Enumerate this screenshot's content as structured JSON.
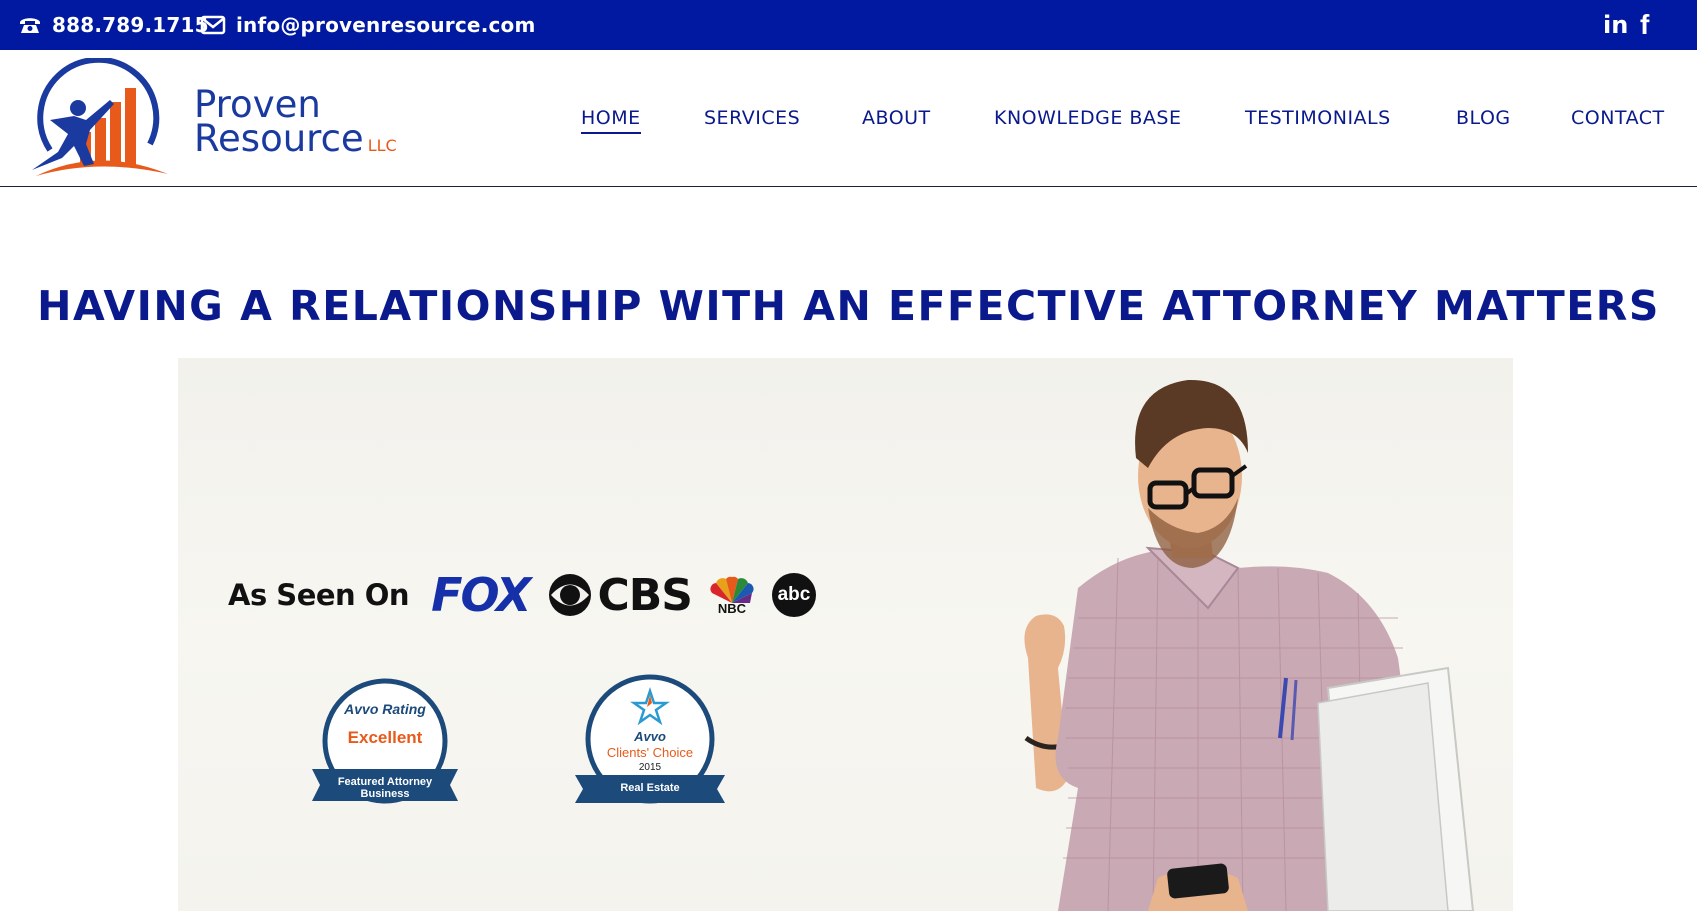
{
  "topbar": {
    "phone": "888.789.1715",
    "email": "info@provenresource.com",
    "social": [
      "linkedin-icon",
      "facebook-icon"
    ]
  },
  "logo": {
    "line1": "Proven",
    "line2": "Resource",
    "suffix": "LLC"
  },
  "nav": {
    "items": [
      "HOME",
      "SERVICES",
      "ABOUT",
      "KNOWLEDGE BASE",
      "TESTIMONIALS",
      "BLOG",
      "CONTACT"
    ],
    "active": "HOME"
  },
  "headline": "HAVING A RELATIONSHIP WITH AN EFFECTIVE ATTORNEY MATTERS",
  "hero": {
    "as_seen_on": "As Seen On",
    "networks": [
      "FOX",
      "CBS",
      "NBC",
      "abc"
    ],
    "badges": [
      {
        "top": "Avvo Rating",
        "main": "Excellent",
        "ribbon": [
          "Featured Attorney",
          "Business"
        ]
      },
      {
        "top": "Avvo",
        "main": "Clients' Choice",
        "year": "2015",
        "ribbon": [
          "Real Estate"
        ]
      }
    ]
  },
  "colors": {
    "topbar_bg": "#0019a0",
    "nav_text": "#0a1a8c",
    "logo_blue": "#1a3aa0",
    "logo_orange": "#e85a1b"
  }
}
